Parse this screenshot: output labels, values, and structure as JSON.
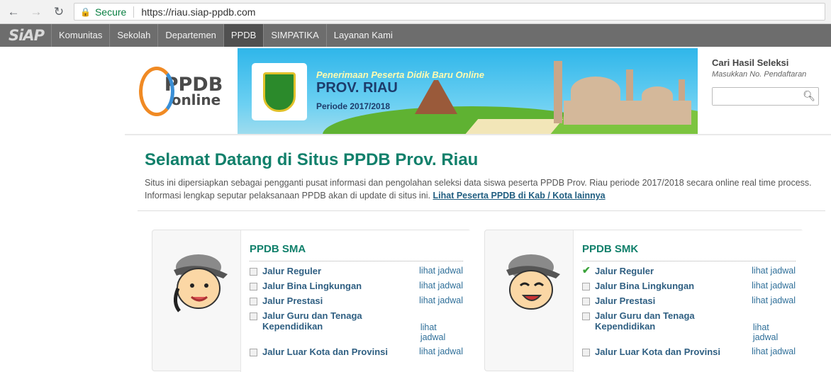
{
  "browser": {
    "secure_label": "Secure",
    "url": "https://riau.siap-ppdb.com"
  },
  "nav": {
    "brand": "SiAP",
    "items": [
      {
        "label": "Komunitas",
        "active": false
      },
      {
        "label": "Sekolah",
        "active": false
      },
      {
        "label": "Departemen",
        "active": false
      },
      {
        "label": "PPDB",
        "active": true
      },
      {
        "label": "SIMPATIKA",
        "active": false
      },
      {
        "label": "Layanan Kami",
        "active": false
      }
    ]
  },
  "header": {
    "logo_line1": "PPDB",
    "logo_line2": "online",
    "banner_line1": "Penerimaan Peserta Didik Baru Online",
    "banner_line2": "PROV. RIAU",
    "banner_line3": "Periode 2017/2018"
  },
  "search": {
    "title": "Cari Hasil Seleksi",
    "subtitle": "Masukkan No. Pendaftaran",
    "value": ""
  },
  "welcome": {
    "title": "Selamat Datang di Situs PPDB Prov. Riau",
    "text": "Situs ini dipersiapkan sebagai pengganti pusat informasi dan pengolahan seleksi data siswa peserta PPDB Prov. Riau periode 2017/2018 secara online real time process. Informasi lengkap seputar pelaksanaan PPDB akan di update di situs ini. ",
    "link": "Lihat Peserta PPDB di Kab / Kota lainnya"
  },
  "panels": [
    {
      "title": "PPDB SMA",
      "rows": [
        {
          "label": "Jalur Reguler",
          "action": "lihat jadwal",
          "checked": false
        },
        {
          "label": "Jalur Bina Lingkungan",
          "action": "lihat jadwal",
          "checked": false
        },
        {
          "label": "Jalur Prestasi",
          "action": "lihat jadwal",
          "checked": false
        },
        {
          "label": "Jalur Guru dan Tenaga Kependidikan",
          "action": "lihat jadwal",
          "checked": false
        },
        {
          "label": "Jalur Luar Kota dan Provinsi",
          "action": "lihat jadwal",
          "checked": false
        }
      ]
    },
    {
      "title": "PPDB SMK",
      "rows": [
        {
          "label": "Jalur Reguler",
          "action": "lihat jadwal",
          "checked": true
        },
        {
          "label": "Jalur Bina Lingkungan",
          "action": "lihat jadwal",
          "checked": false
        },
        {
          "label": "Jalur Prestasi",
          "action": "lihat jadwal",
          "checked": false
        },
        {
          "label": "Jalur Guru dan Tenaga Kependidikan",
          "action": "lihat jadwal",
          "checked": false
        },
        {
          "label": "Jalur Luar Kota dan Provinsi",
          "action": "lihat jadwal",
          "checked": false
        }
      ]
    }
  ]
}
